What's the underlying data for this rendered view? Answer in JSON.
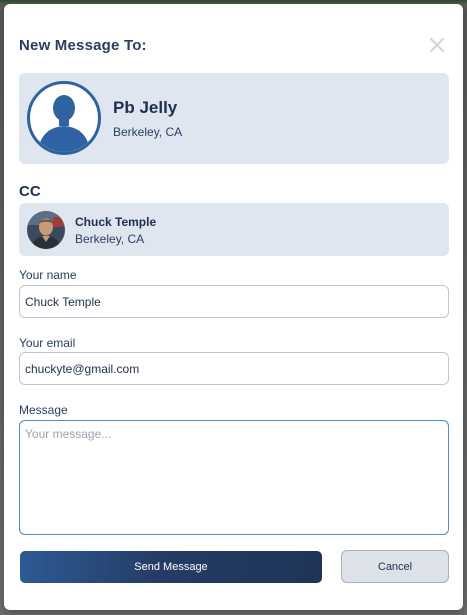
{
  "modal": {
    "title": "New Message To:",
    "close_icon": "close-icon"
  },
  "recipient": {
    "name": "Pb Jelly",
    "location": "Berkeley, CA",
    "avatar_icon": "person-silhouette-icon"
  },
  "cc": {
    "label": "CC",
    "name": "Chuck Temple",
    "location": "Berkeley, CA"
  },
  "form": {
    "name_label": "Your name",
    "name_value": "Chuck Temple",
    "email_label": "Your email",
    "email_value": "chuckyte@gmail.com",
    "message_label": "Message",
    "message_placeholder": "Your message..."
  },
  "actions": {
    "send_label": "Send Message",
    "cancel_label": "Cancel"
  },
  "colors": {
    "accent": "#2f62a3",
    "card_background": "#dfe6ef",
    "title_text": "#2a3d63",
    "send_button": "#243d66"
  }
}
